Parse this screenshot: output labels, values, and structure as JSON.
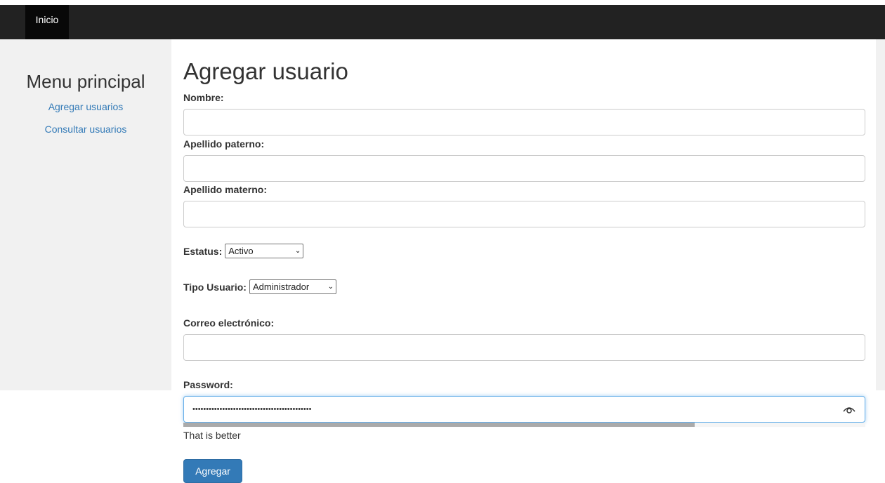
{
  "nav": {
    "home_label": "Inicio"
  },
  "sidebar": {
    "title": "Menu principal",
    "links": [
      {
        "label": "Agregar usuarios"
      },
      {
        "label": "Consultar usuarios"
      }
    ]
  },
  "form": {
    "title": "Agregar usuario",
    "nombre": {
      "label": "Nombre:",
      "value": ""
    },
    "apellido_paterno": {
      "label": "Apellido paterno:",
      "value": ""
    },
    "apellido_materno": {
      "label": "Apellido materno:",
      "value": ""
    },
    "estatus": {
      "label": "Estatus:",
      "selected": "Activo"
    },
    "tipo_usuario": {
      "label": "Tipo Usuario:",
      "selected": "Administrador"
    },
    "correo": {
      "label": "Correo electrónico:",
      "value": ""
    },
    "password": {
      "label": "Password:",
      "masked_value": "••••••••••••••••••••••••••••••••••••••••••••",
      "strength_percent": 75,
      "strength_text": "That is better"
    },
    "submit_label": "Agregar"
  },
  "colors": {
    "navbar": "#222222",
    "sidebar_bg": "#f1f1f1",
    "link": "#337ab7",
    "primary_button": "#337ab7",
    "strength_bar": "#aaaaaa"
  }
}
